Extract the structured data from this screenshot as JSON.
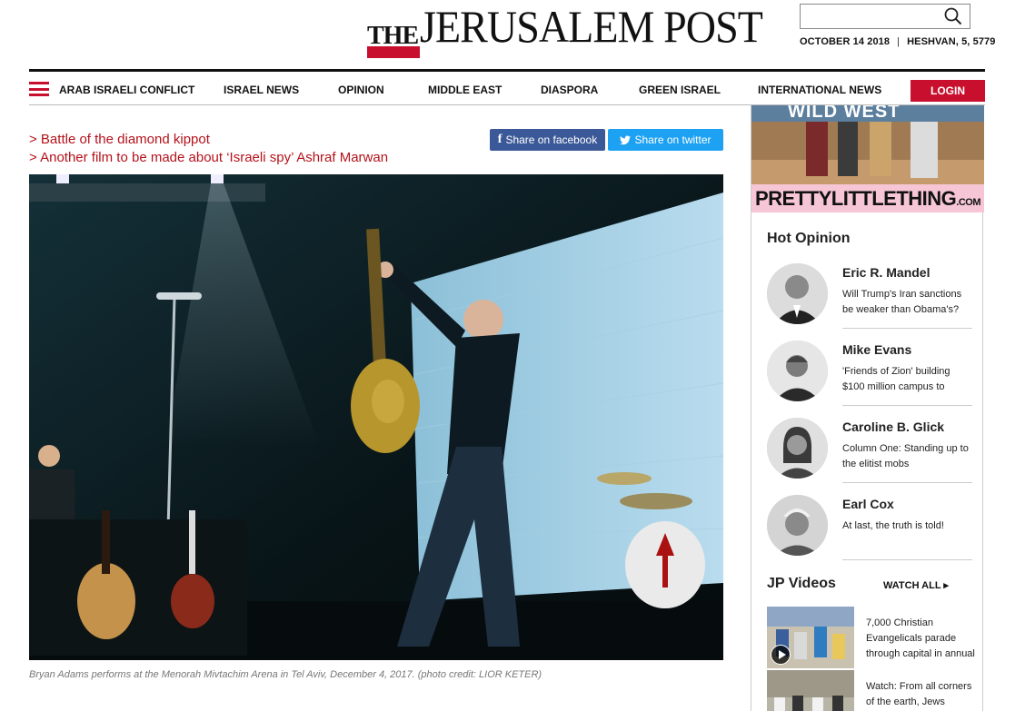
{
  "header": {
    "logo_the": "THE",
    "logo_main": "JERUSALEM POST",
    "date_gregorian": "OCTOBER 14 2018",
    "date_separator": "|",
    "date_hebrew": "HESHVAN, 5, 5779"
  },
  "nav": {
    "items": [
      {
        "label": "ARAB ISRAELI CONFLICT"
      },
      {
        "label": "ISRAEL NEWS"
      },
      {
        "label": "OPINION"
      },
      {
        "label": "MIDDLE EAST"
      },
      {
        "label": "DIASPORA"
      },
      {
        "label": "GREEN ISRAEL"
      },
      {
        "label": "INTERNATIONAL NEWS"
      }
    ],
    "login_label": "LOGIN"
  },
  "related": [
    {
      "label": "> Battle of the diamond kippot"
    },
    {
      "label": "> Another film to be made about ‘Israeli spy’ Ashraf Marwan"
    }
  ],
  "share": {
    "facebook_label": "Share on facebook",
    "twitter_label": "Share on twitter"
  },
  "photo": {
    "caption": "Bryan Adams performs at the Menorah Mivtachim Arena in Tel Aviv, December 4, 2017. (photo credit: LIOR KETER)"
  },
  "sidebar": {
    "ad_brand": "PRETTYLITTLETHING",
    "ad_suffix": ".COM",
    "ad_banner_text": "WILD WEST",
    "hot_opinion_title": "Hot Opinion",
    "opinions": [
      {
        "name": "Eric R. Mandel",
        "text": "Will Trump's Iran sanctions be weaker than Obama's?"
      },
      {
        "name": "Mike Evans",
        "text": "'Friends of Zion' building $100 million campus to"
      },
      {
        "name": "Caroline B. Glick",
        "text": "Column One: Standing up to the elitist mobs"
      },
      {
        "name": "Earl Cox",
        "text": "At last, the truth is told!"
      }
    ],
    "videos_title": "JP Videos",
    "watch_all_label": "WATCH ALL ▸",
    "videos": [
      {
        "text": "7,000 Christian Evangelicals parade through capital in annual"
      },
      {
        "text": "Watch: From all corners of the earth, Jews"
      }
    ]
  },
  "colors": {
    "brand_red": "#c8102e",
    "link_red": "#b5121b",
    "facebook_blue": "#3b5998",
    "twitter_blue": "#1da1f2"
  }
}
